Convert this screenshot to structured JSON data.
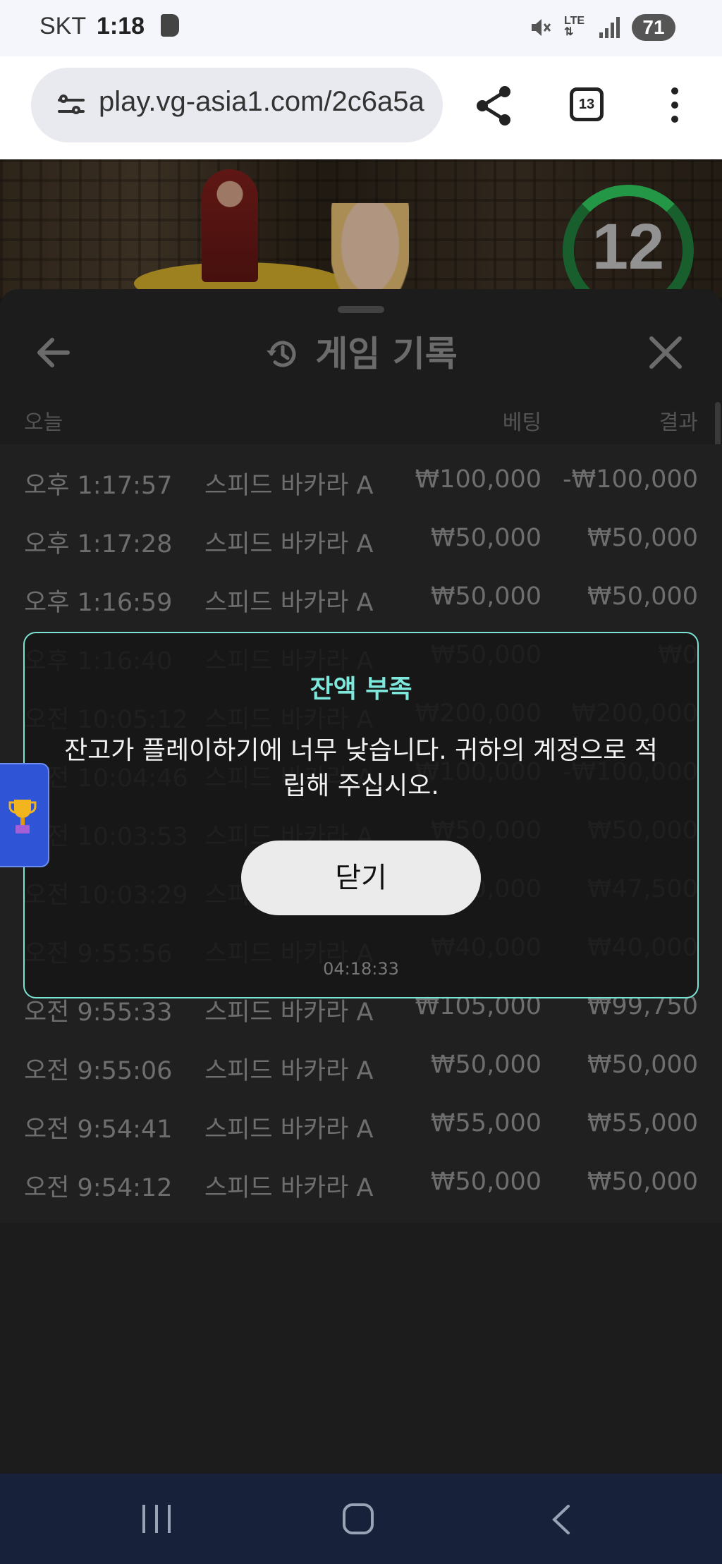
{
  "status_bar": {
    "carrier": "SKT",
    "time": "1:18",
    "network": "LTE",
    "battery": "71"
  },
  "browser": {
    "url": "play.vg-asia1.com/2c6a5a",
    "tab_count": "13"
  },
  "video": {
    "countdown": "12"
  },
  "history": {
    "title": "게임 기록",
    "col_today": "오늘",
    "col_bet": "베팅",
    "col_result": "결과",
    "rows": [
      {
        "time": "오후 1:17:57",
        "game": "스피드 바카라 A",
        "bet": "₩100,000",
        "result": "-₩100,000"
      },
      {
        "time": "오후 1:17:28",
        "game": "스피드 바카라 A",
        "bet": "₩50,000",
        "result": "₩50,000"
      },
      {
        "time": "오후 1:16:59",
        "game": "스피드 바카라 A",
        "bet": "₩50,000",
        "result": "₩50,000"
      },
      {
        "time": "오후 1:16:40",
        "game": "스피드 바카라 A",
        "bet": "₩50,000",
        "result": "₩0"
      },
      {
        "time": "오전 10:05:12",
        "game": "스피드 바카라 A",
        "bet": "₩200,000",
        "result": "₩200,000"
      },
      {
        "time": "오전 10:04:46",
        "game": "스피드 바카라 A",
        "bet": "₩100,000",
        "result": "-₩100,000"
      },
      {
        "time": "오전 10:03:53",
        "game": "스피드 바카라 A",
        "bet": "₩50,000",
        "result": "₩50,000"
      },
      {
        "time": "오전 10:03:29",
        "game": "스피드 바카라 A",
        "bet": "₩50,000",
        "result": "₩47,500"
      },
      {
        "time": "오전 9:55:56",
        "game": "스피드 바카라 A",
        "bet": "₩40,000",
        "result": "₩40,000"
      },
      {
        "time": "오전 9:55:33",
        "game": "스피드 바카라 A",
        "bet": "₩105,000",
        "result": "₩99,750"
      },
      {
        "time": "오전 9:55:06",
        "game": "스피드 바카라 A",
        "bet": "₩50,000",
        "result": "₩50,000"
      },
      {
        "time": "오전 9:54:41",
        "game": "스피드 바카라 A",
        "bet": "₩55,000",
        "result": "₩55,000"
      },
      {
        "time": "오전 9:54:12",
        "game": "스피드 바카라 A",
        "bet": "₩50,000",
        "result": "₩50,000"
      }
    ]
  },
  "dialog": {
    "title": "잔액 부족",
    "message": "잔고가 플레이하기에 너무 낮습니다. 귀하의 계정으로 적립해 주십시오.",
    "button": "닫기",
    "timestamp": "04:18:33"
  },
  "colors": {
    "accent": "#7fe8dc",
    "timer_green": "#2fc25a",
    "nav_bg": "#17213a",
    "trophy_tab": "#2f54d6"
  },
  "icons": [
    "mute-icon",
    "lte-icon",
    "signal-icon",
    "tune-icon",
    "share-icon",
    "tabs-icon",
    "more-icon",
    "back-arrow-icon",
    "history-icon",
    "close-icon",
    "trophy-icon",
    "recent-apps-icon",
    "home-icon",
    "back-icon"
  ]
}
